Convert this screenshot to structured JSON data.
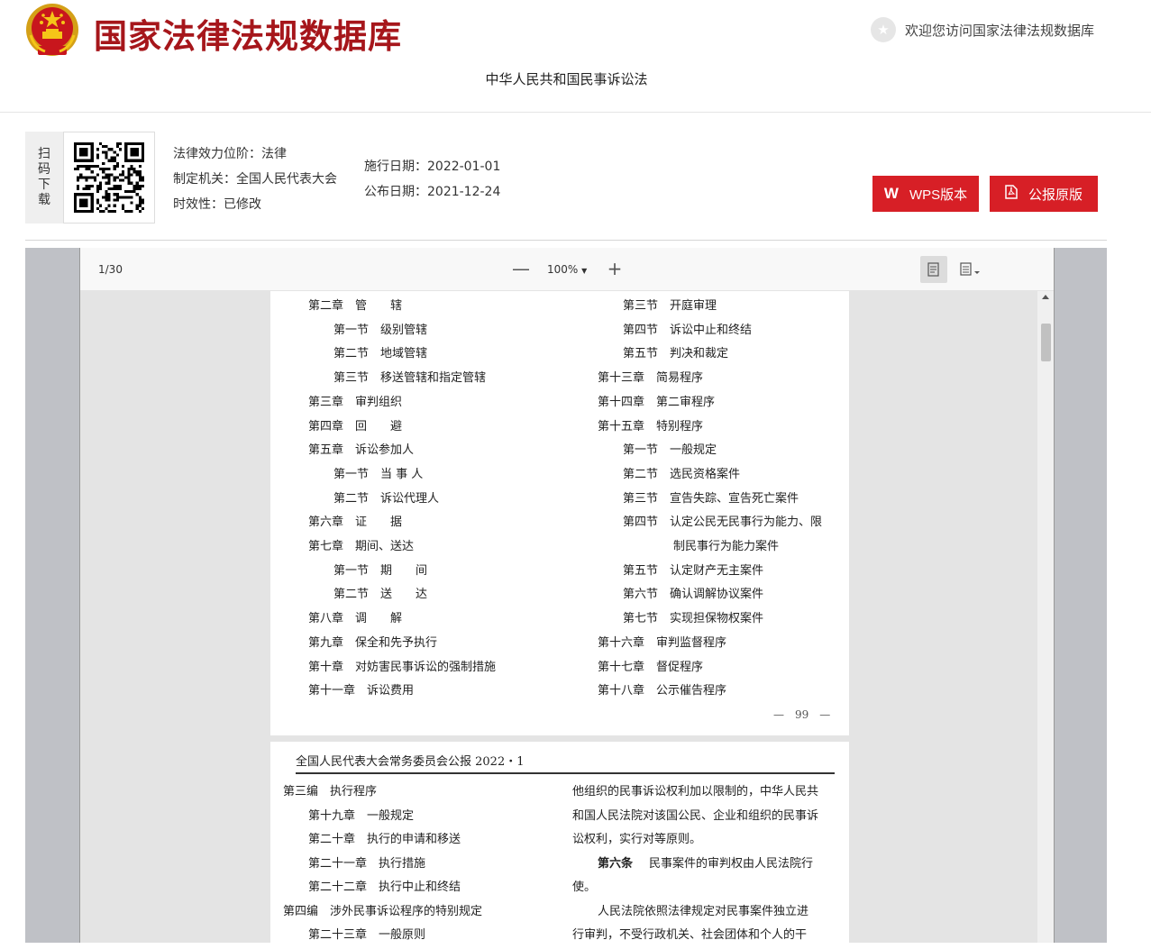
{
  "header": {
    "site_title": "国家法律法规数据库",
    "welcome": "欢迎您访问国家法律法规数据库",
    "law_title": "中华人民共和国民事诉讼法"
  },
  "info": {
    "scan_label": [
      "扫",
      "码",
      "下",
      "载"
    ],
    "effect_level": "法律效力位阶：法律",
    "issuing_body": "制定机关：全国人民代表大会",
    "validity": "时效性：已修改",
    "effective_date": "施行日期：2022-01-01",
    "publish_date": "公布日期：2021-12-24",
    "wps_button": "WPS版本",
    "gazette_button": "公报原版"
  },
  "viewer": {
    "page_indicator": "1/30",
    "zoom_out": "—",
    "zoom": "100%",
    "zoom_in": "+"
  },
  "page1": {
    "left": [
      "第二章　管　　辖",
      "第一节　级别管辖",
      "第二节　地域管辖",
      "第三节　移送管辖和指定管辖",
      "第三章　审判组织",
      "第四章　回　　避",
      "第五章　诉讼参加人",
      "第一节　当 事 人",
      "第二节　诉讼代理人",
      "第六章　证　　据",
      "第七章　期间、送达",
      "第一节　期　　间",
      "第二节　送　　达",
      "第八章　调　　解",
      "第九章　保全和先予执行",
      "第十章　对妨害民事诉讼的强制措施",
      "第十一章　诉讼费用"
    ],
    "right": [
      "第三节　开庭审理",
      "第四节　诉讼中止和终结",
      "第五节　判决和裁定",
      "第十三章　简易程序",
      "第十四章　第二审程序",
      "第十五章　特别程序",
      "第一节　一般规定",
      "第二节　选民资格案件",
      "第三节　宣告失踪、宣告死亡案件",
      "第四节　认定公民无民事行为能力、限",
      "制民事行为能力案件",
      "第五节　认定财产无主案件",
      "第六节　确认调解协议案件",
      "第七节　实现担保物权案件",
      "第十六章　审判监督程序",
      "第十七章　督促程序",
      "第十八章　公示催告程序"
    ],
    "page_number": "—　99　—"
  },
  "page2": {
    "header": "全国人民代表大会常务委员会公报 2022・1",
    "left": [
      "第三编　执行程序",
      "第十九章　一般规定",
      "第二十章　执行的申请和移送",
      "第二十一章　执行措施",
      "第二十二章　执行中止和终结",
      "第四编　涉外民事诉讼程序的特别规定",
      "第二十三章　一般原则"
    ],
    "right": [
      "他组织的民事诉讼权利加以限制的，中华人民共",
      "和国人民法院对该国公民、企业和组织的民事诉",
      "讼权利，实行对等原则。",
      "第六条",
      "民事案件的审判权由人民法院行",
      "使。",
      "人民法院依照法律规定对民事案件独立进",
      "行审判，不受行政机关、社会团体和个人的干"
    ]
  }
}
